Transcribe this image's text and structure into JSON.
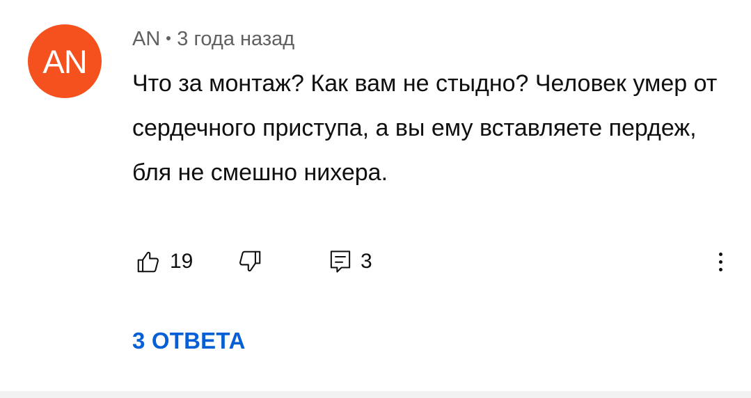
{
  "comment": {
    "avatar": {
      "initials": "AN",
      "color": "#f5511e"
    },
    "author": "AN",
    "timestamp": "3 года назад",
    "text": "Что за монтаж? Как вам не стыдно? Человек умер от сердечного приступа, а вы ему вставляете пердеж, бля не смешно нихера.",
    "actions": {
      "like_icon": "thumbs-up-icon",
      "like_count": "19",
      "dislike_icon": "thumbs-down-icon",
      "reply_icon": "comment-reply-icon",
      "reply_count": "3",
      "more_icon": "more-vertical-icon"
    },
    "replies_label": "3 ОТВЕТА",
    "link_color": "#065fd4"
  }
}
